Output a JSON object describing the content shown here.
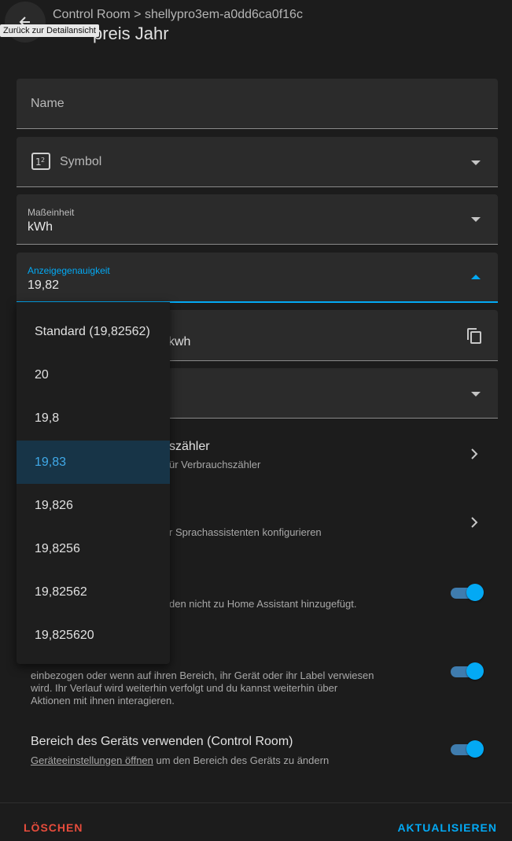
{
  "header": {
    "breadcrumb": "Control Room > shellypro3em-a0dd6ca0f16c",
    "title_visible": "preis Jahr",
    "back_tooltip": "Zurück zur Detailansicht"
  },
  "fields": {
    "name": {
      "label": "Name"
    },
    "symbol": {
      "label": "Symbol",
      "icon": "numeric-box-icon"
    },
    "unit": {
      "label": "Maßeinheit",
      "value": "kWh"
    },
    "precision": {
      "label": "Anzeigegenauigkeit",
      "value": "19,82"
    },
    "entity_id": {
      "value_tail": "kwh",
      "icon": "copy-icon"
    }
  },
  "dropdown": {
    "options": [
      "Standard (19,82562)",
      "20",
      "19,8",
      "19,83",
      "19,826",
      "19,8256",
      "19,82562",
      "19,825620"
    ],
    "selected": "19,83"
  },
  "rows": {
    "meter": {
      "title_tail": "szähler",
      "subtitle_tail": "ür Verbrauchszähler"
    },
    "voice": {
      "subtitle_tail": "r Sprachassistenten konfigurieren"
    },
    "enabled": {
      "subtitle_tail": "den nicht zu Home Assistant hinzugefügt."
    },
    "visible": {
      "desc_lines": [
        "einbezogen oder wenn auf ihren Bereich, ihr Gerät oder ihr Label verwiesen",
        "wird. Ihr Verlauf wird weiterhin verfolgt und du kannst weiterhin über",
        "Aktionen mit ihnen interagieren."
      ]
    },
    "area": {
      "title": "Bereich des Geräts verwenden (Control Room)",
      "link": "Geräteeinstellungen öffnen",
      "subtitle_rest": " um den Bereich des Geräts zu ändern"
    }
  },
  "footer": {
    "delete_label": "LÖSCHEN",
    "update_label": "AKTUALISIEREN"
  },
  "colors": {
    "accent": "#03a9f4",
    "danger": "#e74c3c",
    "selected_bg": "#173447"
  }
}
